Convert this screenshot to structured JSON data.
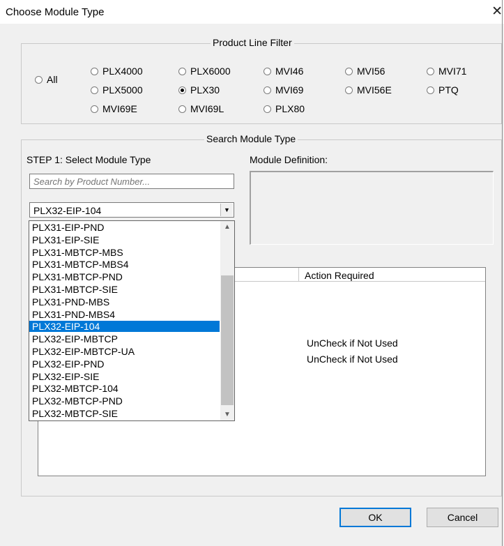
{
  "window": {
    "title": "Choose Module Type",
    "close_glyph": "✕"
  },
  "product_line_filter": {
    "legend": "Product Line Filter",
    "options": [
      {
        "label": "All",
        "checked": false
      },
      {
        "label": "PLX4000",
        "checked": false
      },
      {
        "label": "PLX5000",
        "checked": false
      },
      {
        "label": "MVI69E",
        "checked": false
      },
      {
        "label": "PLX6000",
        "checked": false
      },
      {
        "label": "PLX30",
        "checked": true
      },
      {
        "label": "MVI69L",
        "checked": false
      },
      {
        "label": "MVI46",
        "checked": false
      },
      {
        "label": "MVI69",
        "checked": false
      },
      {
        "label": "PLX80",
        "checked": false
      },
      {
        "label": "MVI56",
        "checked": false
      },
      {
        "label": "MVI56E",
        "checked": false
      },
      {
        "label": "MVI71",
        "checked": false
      },
      {
        "label": "PTQ",
        "checked": false
      }
    ]
  },
  "search_module_type": {
    "legend": "Search Module Type",
    "step1_label": "STEP 1: Select Module Type",
    "module_definition_label": "Module Definition:",
    "search_placeholder": "Search by Product Number...",
    "selected_module": "PLX32-EIP-104",
    "dropdown_items": [
      "PLX31-EIP-PND",
      "PLX31-EIP-SIE",
      "PLX31-MBTCP-MBS",
      "PLX31-MBTCP-MBS4",
      "PLX31-MBTCP-PND",
      "PLX31-MBTCP-SIE",
      "PLX31-PND-MBS",
      "PLX31-PND-MBS4",
      "PLX32-EIP-104",
      "PLX32-EIP-MBTCP",
      "PLX32-EIP-MBTCP-UA",
      "PLX32-EIP-PND",
      "PLX32-EIP-SIE",
      "PLX32-MBTCP-104",
      "PLX32-MBTCP-PND",
      "PLX32-MBTCP-SIE"
    ],
    "selected_index": 8
  },
  "table": {
    "column_action": "Action Required",
    "rows": [
      "UnCheck if Not Used",
      "UnCheck if Not Used"
    ]
  },
  "buttons": {
    "ok": "OK",
    "cancel": "Cancel"
  },
  "icons": {
    "up": "scroll-up-icon",
    "down": "scroll-down-icon",
    "combo": "chevron-down-icon"
  },
  "colors": {
    "selection": "#0078d7"
  }
}
